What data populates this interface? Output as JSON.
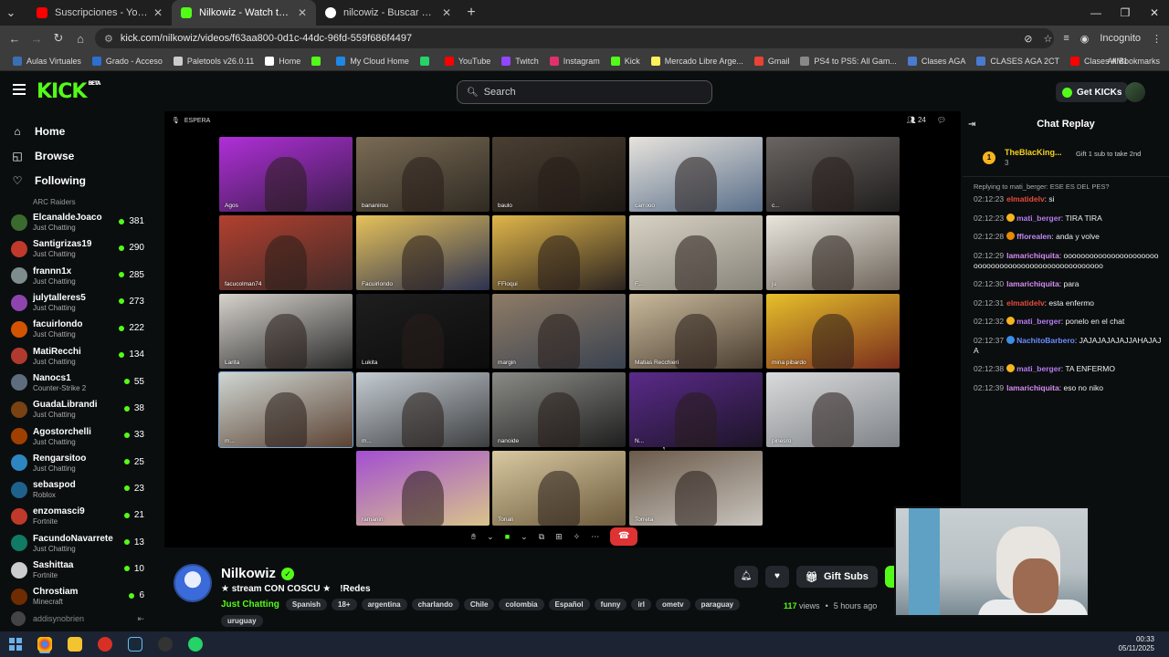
{
  "browser": {
    "tabs": [
      {
        "title": "Suscripciones - YouTube",
        "color": "#ff0000"
      },
      {
        "title": "Nilkowiz - Watch the VOD ...",
        "color": "#53fc18"
      },
      {
        "title": "nilcowiz - Buscar con Google",
        "color": "#ffffff"
      }
    ],
    "url": "kick.com/nilkowiz/videos/f63aa800-0d1c-44dc-96fd-559f686f4497",
    "profile_label": "Incognito",
    "bookmarks": [
      {
        "label": "Aulas Virtuales",
        "color": "#3a6fb5"
      },
      {
        "label": "Grado - Acceso",
        "color": "#2d6fd1"
      },
      {
        "label": "Paletools v26.0.11",
        "color": "#cccccc"
      },
      {
        "label": "Home",
        "color": "#ffffff"
      },
      {
        "label": "",
        "color": "#53fc18"
      },
      {
        "label": "My Cloud Home",
        "color": "#1e88e5"
      },
      {
        "label": "",
        "color": "#25d366"
      },
      {
        "label": "YouTube",
        "color": "#ff0000"
      },
      {
        "label": "Twitch",
        "color": "#9146ff"
      },
      {
        "label": "Instagram",
        "color": "#e1306c"
      },
      {
        "label": "Kick",
        "color": "#53fc18"
      },
      {
        "label": "Mercado Libre Arge...",
        "color": "#fff159"
      },
      {
        "label": "Gmail",
        "color": "#ea4335"
      },
      {
        "label": "PS4 to PS5: All Gam...",
        "color": "#888888"
      },
      {
        "label": "Clases AGA",
        "color": "#4a7bd0"
      },
      {
        "label": "CLASES AGA 2CT",
        "color": "#4a7bd0"
      },
      {
        "label": "Clases AM1",
        "color": "#ff0000"
      }
    ],
    "all_bookmarks": "All Bookmarks"
  },
  "kick": {
    "logo": "KICK",
    "logo_sup": "BETA",
    "search_placeholder": "Search",
    "get_kicks": "Get KICKs"
  },
  "sidebar": {
    "nav": [
      {
        "label": "Home",
        "icon": "⌂"
      },
      {
        "label": "Browse",
        "icon": "◱"
      },
      {
        "label": "Following",
        "icon": "♡"
      }
    ],
    "cut_label": "ARC Raiders",
    "channels": [
      {
        "name": "ElcanaldeJoaco",
        "category": "Just Chatting",
        "viewers": "381",
        "color": "#3b6a2f"
      },
      {
        "name": "Santigrizas19",
        "category": "Just Chatting",
        "viewers": "290",
        "color": "#c0392b"
      },
      {
        "name": "frannn1x",
        "category": "Just Chatting",
        "viewers": "285",
        "color": "#7f8c8d"
      },
      {
        "name": "julytalleres5",
        "category": "Just Chatting",
        "viewers": "273",
        "color": "#8e44ad"
      },
      {
        "name": "facuirlondo",
        "category": "Just Chatting",
        "viewers": "222",
        "color": "#d35400"
      },
      {
        "name": "MatiRecchi",
        "category": "Just Chatting",
        "viewers": "134",
        "color": "#b03a2e"
      },
      {
        "name": "Nanocs1",
        "category": "Counter-Strike 2",
        "viewers": "55",
        "color": "#5d6d7e"
      },
      {
        "name": "GuadaLibrandi",
        "category": "Just Chatting",
        "viewers": "38",
        "color": "#784212"
      },
      {
        "name": "Agostorchelli",
        "category": "Just Chatting",
        "viewers": "33",
        "color": "#a04000"
      },
      {
        "name": "Rengarsitoo",
        "category": "Just Chatting",
        "viewers": "25",
        "color": "#2e86c1"
      },
      {
        "name": "sebaspod",
        "category": "Roblox",
        "viewers": "23",
        "color": "#1f618d"
      },
      {
        "name": "enzomasci9",
        "category": "Fortnite",
        "viewers": "21",
        "color": "#c0392b"
      },
      {
        "name": "FacundoNavarrete",
        "category": "Just Chatting",
        "viewers": "13",
        "color": "#117a65"
      },
      {
        "name": "Sashittaa",
        "category": "Fortnite",
        "viewers": "10",
        "color": "#cccccc"
      },
      {
        "name": "Chrostiam",
        "category": "Minecraft",
        "viewers": "6",
        "color": "#6e2c00"
      }
    ],
    "offline_name": "addisynobrien"
  },
  "video": {
    "label": "ESPERA",
    "participants_count": "24",
    "tiles": [
      {
        "name": "Agos",
        "c1": "#b02fd8",
        "c2": "#3a1d4a"
      },
      {
        "name": "bananirou",
        "c1": "#7a6b55",
        "c2": "#2f2a22"
      },
      {
        "name": "baulo",
        "c1": "#4b3f33",
        "c2": "#1c1813"
      },
      {
        "name": "carrooo",
        "c1": "#e7e3dc",
        "c2": "#5a6f8a"
      },
      {
        "name": "c...",
        "c1": "#6a6563",
        "c2": "#1f1d1c"
      },
      {
        "name": "facucolman74",
        "c1": "#b2402f",
        "c2": "#3f2a28"
      },
      {
        "name": "Facuirlondo",
        "c1": "#e6c25a",
        "c2": "#2c3150"
      },
      {
        "name": "FFloqui",
        "c1": "#e0b64a",
        "c2": "#2b2320"
      },
      {
        "name": "F...",
        "c1": "#d8d2c4",
        "c2": "#87847a"
      },
      {
        "name": "ju",
        "c1": "#e9e6de",
        "c2": "#6e655c"
      },
      {
        "name": "Larita",
        "c1": "#d6d2cc",
        "c2": "#2a2a2a"
      },
      {
        "name": "Lukita",
        "c1": "#1e1e1e",
        "c2": "#0c0c0c"
      },
      {
        "name": "margin",
        "c1": "#8f7c66",
        "c2": "#3a4250"
      },
      {
        "name": "Matias Recchieri",
        "c1": "#c9ba9c",
        "c2": "#4a3d30"
      },
      {
        "name": "mina pibardo",
        "c1": "#e6c02a",
        "c2": "#7a2c1c"
      },
      {
        "name": "m...",
        "c1": "#cfd6d2",
        "c2": "#5b4233"
      },
      {
        "name": "m...",
        "c1": "#c4ccd2",
        "c2": "#3d3e40"
      },
      {
        "name": "nanoide",
        "c1": "#8a8a86",
        "c2": "#1e1e1e"
      },
      {
        "name": "N...",
        "c1": "#5a2a8a",
        "c2": "#1c1426"
      },
      {
        "name": "pinesro",
        "c1": "#d9dadb",
        "c2": "#7f8388"
      },
      {
        "name": "ramanin",
        "c1": "#a34fd1",
        "c2": "#d8c48a"
      },
      {
        "name": "Tonali",
        "c1": "#d9c9a1",
        "c2": "#6c5a3c"
      },
      {
        "name": "Torreta",
        "c1": "#6a5a4a",
        "c2": "#c9c4bd"
      }
    ]
  },
  "stream": {
    "streamer": "Nilkowiz",
    "title": "★ stream CON COSCU ★",
    "socials": "!Redes",
    "category": "Just Chatting",
    "tags": [
      "Spanish",
      "18+",
      "argentina",
      "charlando",
      "Chile",
      "colombia",
      "Español",
      "funny",
      "irl",
      "ometv",
      "paraguay"
    ],
    "tags_row2": [
      "uruguay"
    ],
    "views": "117",
    "views_label": "views",
    "time_ago": "5 hours ago",
    "gift_subs": "Gift Subs",
    "sub_label": "S"
  },
  "chat": {
    "title": "Chat Replay",
    "pinned": {
      "rank": "1",
      "name": "TheBlacKing...",
      "count": "3",
      "gift_text": "Gift 1 sub to take 2nd"
    },
    "reply_to": "Replying to mati_berger: ESE ES DEL PES?",
    "messages": [
      {
        "ts": "02:12:23",
        "user": "elmatidelv",
        "text": "si",
        "color": "#e74c3c",
        "badge": ""
      },
      {
        "ts": "02:12:23",
        "user": "mati_berger",
        "text": "TIRA TIRA",
        "color": "#b67cf0",
        "badge": "#f7b51c"
      },
      {
        "ts": "02:12:28",
        "user": "fflorealen",
        "text": "anda y volve",
        "color": "#c08cf0",
        "badge": "#e68a00"
      },
      {
        "ts": "02:12:29",
        "user": "lamarichiquita",
        "text": "oooooooooooooooooooooooooooooooooooooooooooooooooooo",
        "color": "#d78cf5",
        "badge": ""
      },
      {
        "ts": "02:12:30",
        "user": "lamarichiquita",
        "text": "para",
        "color": "#d78cf5",
        "badge": ""
      },
      {
        "ts": "02:12:31",
        "user": "elmatidelv",
        "text": "esta enfermo",
        "color": "#e74c3c",
        "badge": ""
      },
      {
        "ts": "02:12:32",
        "user": "mati_berger",
        "text": "ponelo en el chat",
        "color": "#b67cf0",
        "badge": "#f7b51c"
      },
      {
        "ts": "02:12:37",
        "user": "NachitoBarbero",
        "text": "JAJAJAJAJAJJAHAJAJA",
        "color": "#6a8cff",
        "badge": "#3a8ee6"
      },
      {
        "ts": "02:12:38",
        "user": "mati_berger",
        "text": "TA ENFERMO",
        "color": "#b67cf0",
        "badge": "#f7b51c"
      },
      {
        "ts": "02:12:39",
        "user": "lamarichiquita",
        "text": "eso no niko",
        "color": "#d78cf5",
        "badge": ""
      }
    ]
  },
  "taskbar": {
    "time": "00:33",
    "date": "05/11/2025"
  }
}
